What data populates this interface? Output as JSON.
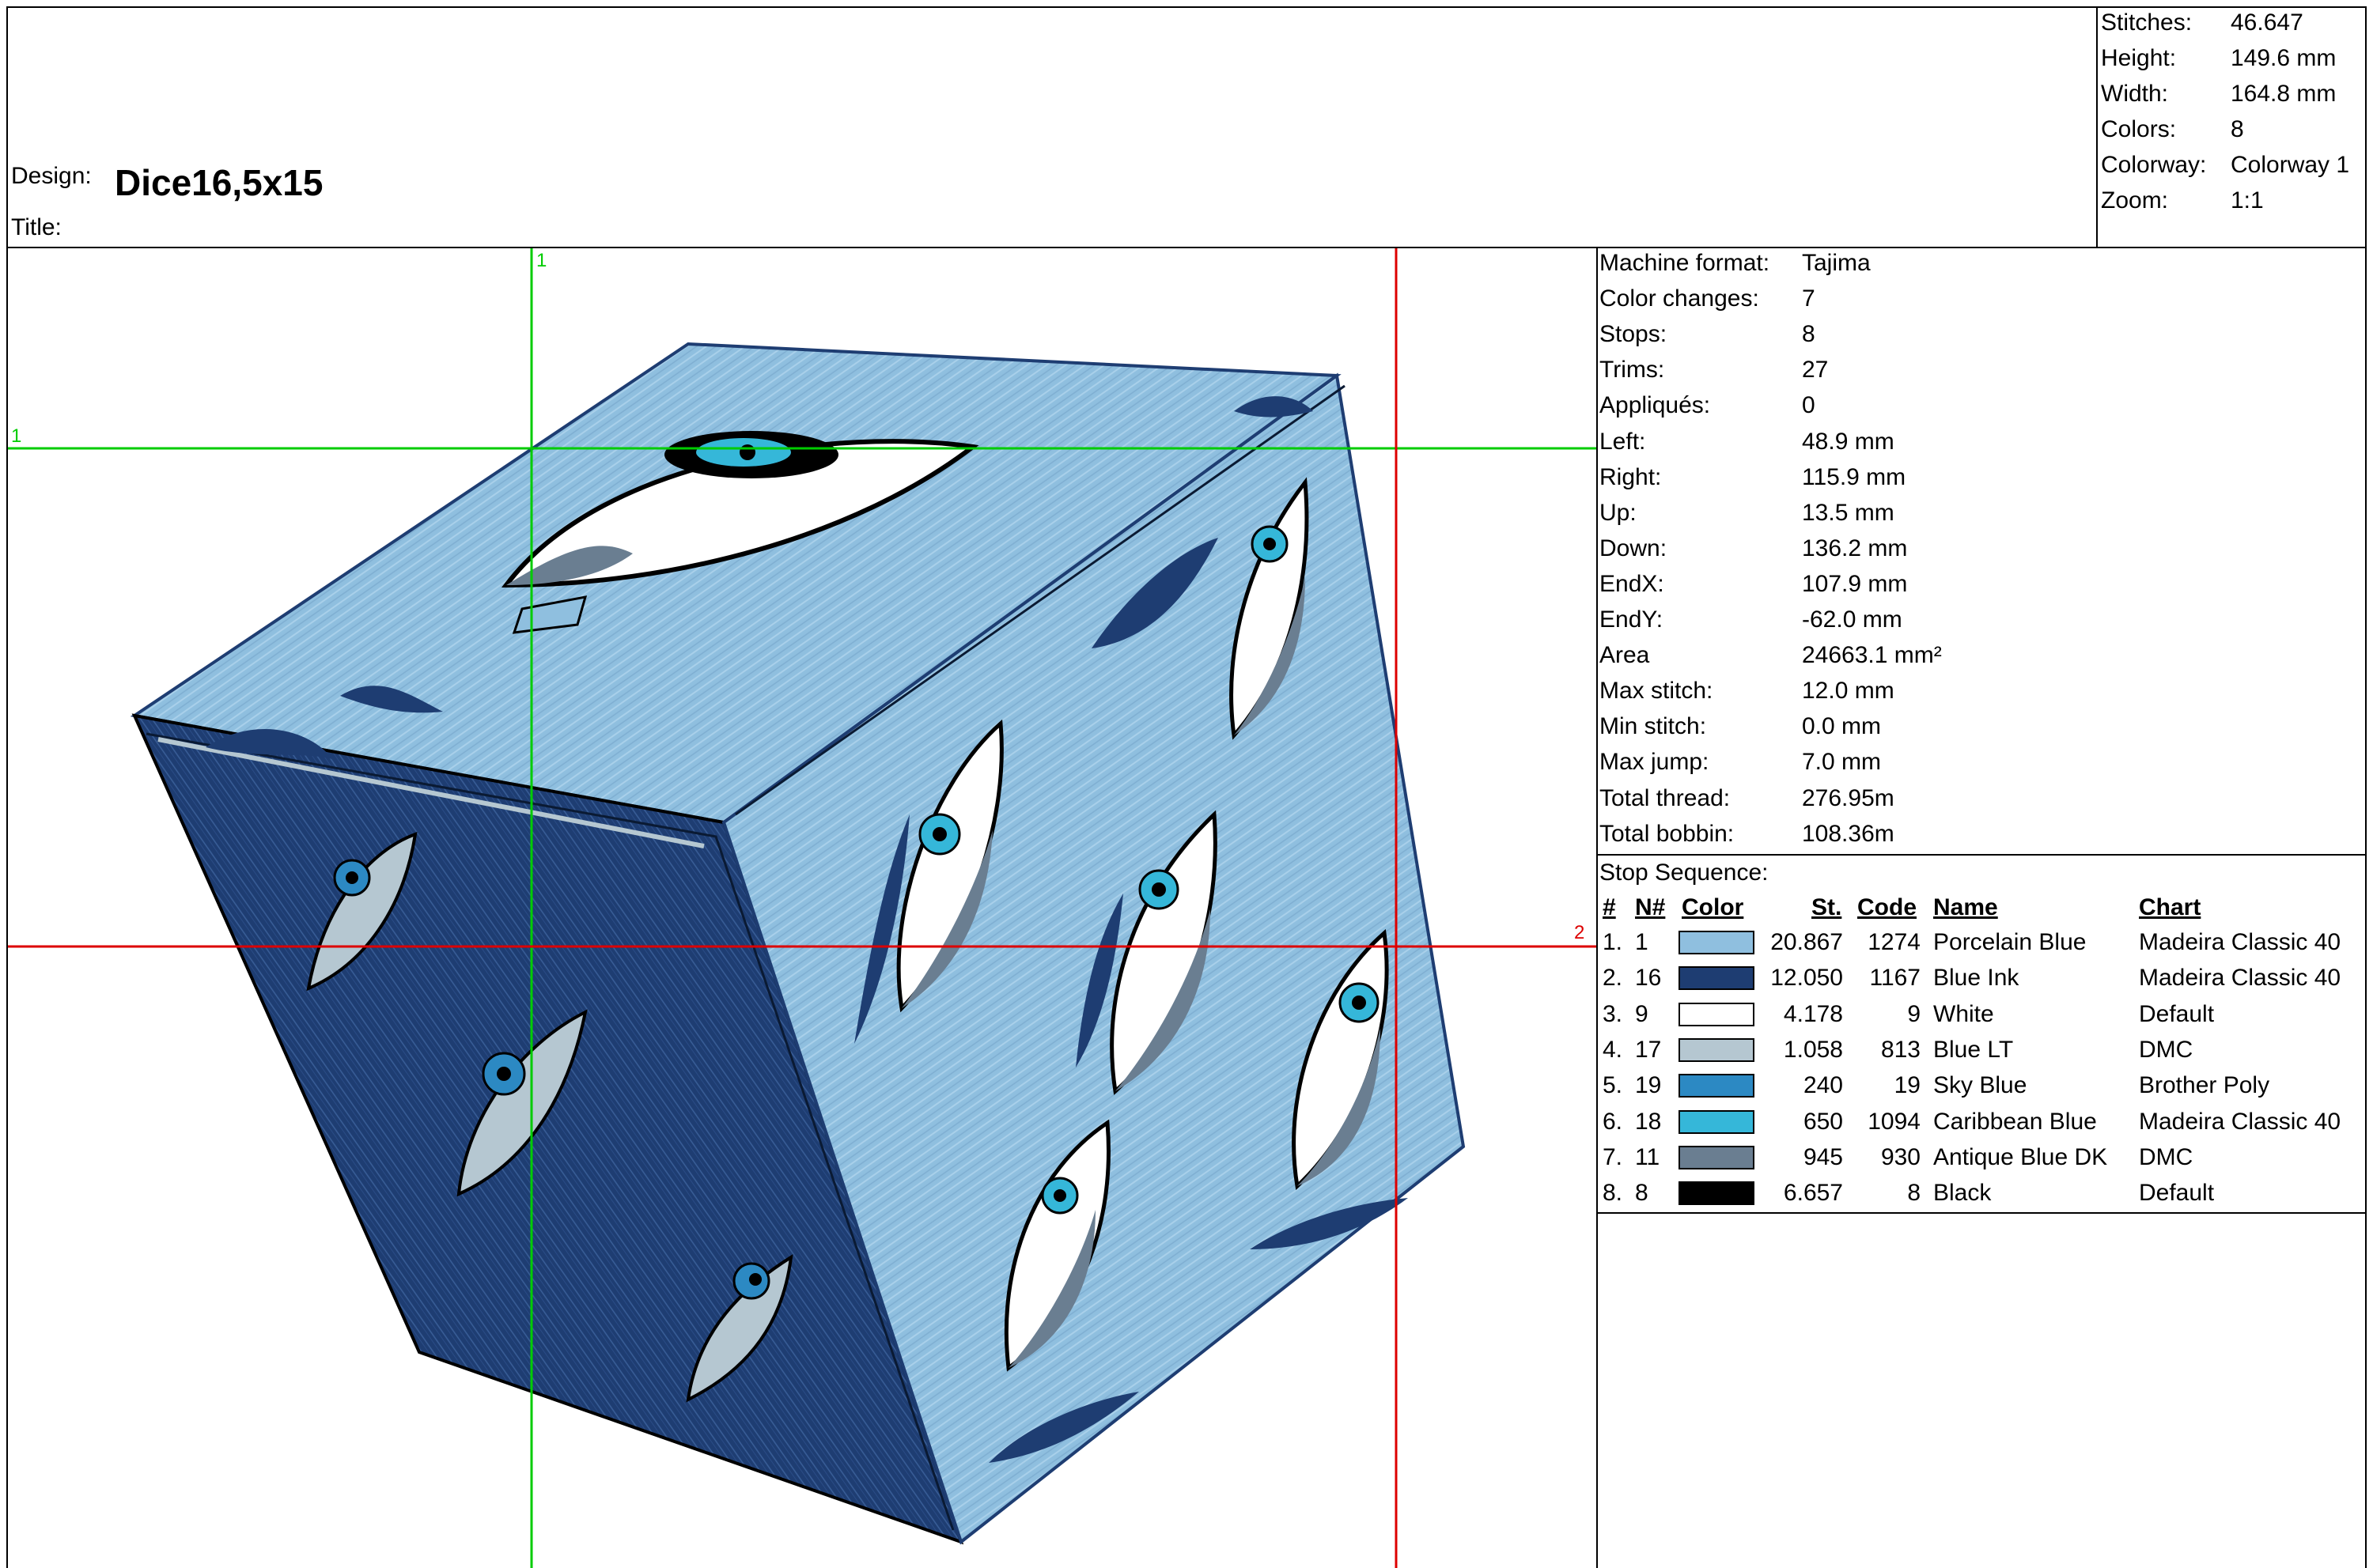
{
  "header": {
    "design_label": "Design:",
    "design_name": "Dice16,5x15",
    "title_label": "Title:",
    "title_value": ""
  },
  "summary": [
    {
      "label": "Stitches:",
      "value": "46.647"
    },
    {
      "label": "Height:",
      "value": "149.6 mm"
    },
    {
      "label": "Width:",
      "value": "164.8 mm"
    },
    {
      "label": "Colors:",
      "value": "8"
    },
    {
      "label": "Colorway:",
      "value": "Colorway 1"
    },
    {
      "label": "Zoom:",
      "value": "1:1"
    }
  ],
  "details": [
    {
      "label": "Machine format:",
      "value": "Tajima"
    },
    {
      "label": "Color changes:",
      "value": "7"
    },
    {
      "label": "Stops:",
      "value": "8"
    },
    {
      "label": "Trims:",
      "value": "27"
    },
    {
      "label": "Appliqués:",
      "value": "0"
    },
    {
      "label": "Left:",
      "value": "48.9 mm"
    },
    {
      "label": "Right:",
      "value": "115.9 mm"
    },
    {
      "label": "Up:",
      "value": "13.5 mm"
    },
    {
      "label": "Down:",
      "value": "136.2 mm"
    },
    {
      "label": "EndX:",
      "value": "107.9 mm"
    },
    {
      "label": "EndY:",
      "value": "-62.0 mm"
    },
    {
      "label": "Area",
      "value": "24663.1 mm²"
    },
    {
      "label": "Max stitch:",
      "value": "12.0 mm"
    },
    {
      "label": "Min stitch:",
      "value": "0.0 mm"
    },
    {
      "label": "Max jump:",
      "value": "7.0 mm"
    },
    {
      "label": "Total thread:",
      "value": "276.95m"
    },
    {
      "label": "Total bobbin:",
      "value": "108.36m"
    }
  ],
  "stop_sequence": {
    "title": "Stop Sequence:",
    "headers": {
      "idx": "#",
      "n": "N#",
      "color": "Color",
      "st": "St.",
      "code": "Code",
      "name": "Name",
      "chart": "Chart"
    },
    "rows": [
      {
        "idx": "1.",
        "n": "1",
        "color": "#8fbfdf",
        "st": "20.867",
        "code": "1274",
        "name": "Porcelain Blue",
        "chart": "Madeira Classic 40"
      },
      {
        "idx": "2.",
        "n": "16",
        "color": "#1e3d72",
        "st": "12.050",
        "code": "1167",
        "name": "Blue Ink",
        "chart": "Madeira Classic 40"
      },
      {
        "idx": "3.",
        "n": "9",
        "color": "#ffffff",
        "st": "4.178",
        "code": "9",
        "name": "White",
        "chart": "Default"
      },
      {
        "idx": "4.",
        "n": "17",
        "color": "#b5c7d1",
        "st": "1.058",
        "code": "813",
        "name": "Blue LT",
        "chart": "DMC"
      },
      {
        "idx": "5.",
        "n": "19",
        "color": "#2c89c3",
        "st": "240",
        "code": "19",
        "name": "Sky Blue",
        "chart": "Brother Poly"
      },
      {
        "idx": "6.",
        "n": "18",
        "color": "#35b7d9",
        "st": "650",
        "code": "1094",
        "name": "Caribbean Blue",
        "chart": "Madeira Classic 40"
      },
      {
        "idx": "7.",
        "n": "11",
        "color": "#6a7e91",
        "st": "945",
        "code": "930",
        "name": "Antique Blue DK",
        "chart": "DMC"
      },
      {
        "idx": "8.",
        "n": "8",
        "color": "#000000",
        "st": "6.657",
        "code": "8",
        "name": "Black",
        "chart": "Default"
      }
    ]
  },
  "guides": {
    "green_vertical_label": "1",
    "green_horizontal_label": "1",
    "red_horizontal_label": "2",
    "green_color": "#00cc00",
    "red_color": "#dd0000"
  },
  "palette": {
    "porcelain_blue": "#8fbfdf",
    "blue_ink": "#1e3d72",
    "blue_lt": "#b5c7d1",
    "sky_blue": "#2c89c3",
    "caribbean_blue": "#35b7d9",
    "antique_blue_dk": "#6a7e91"
  }
}
